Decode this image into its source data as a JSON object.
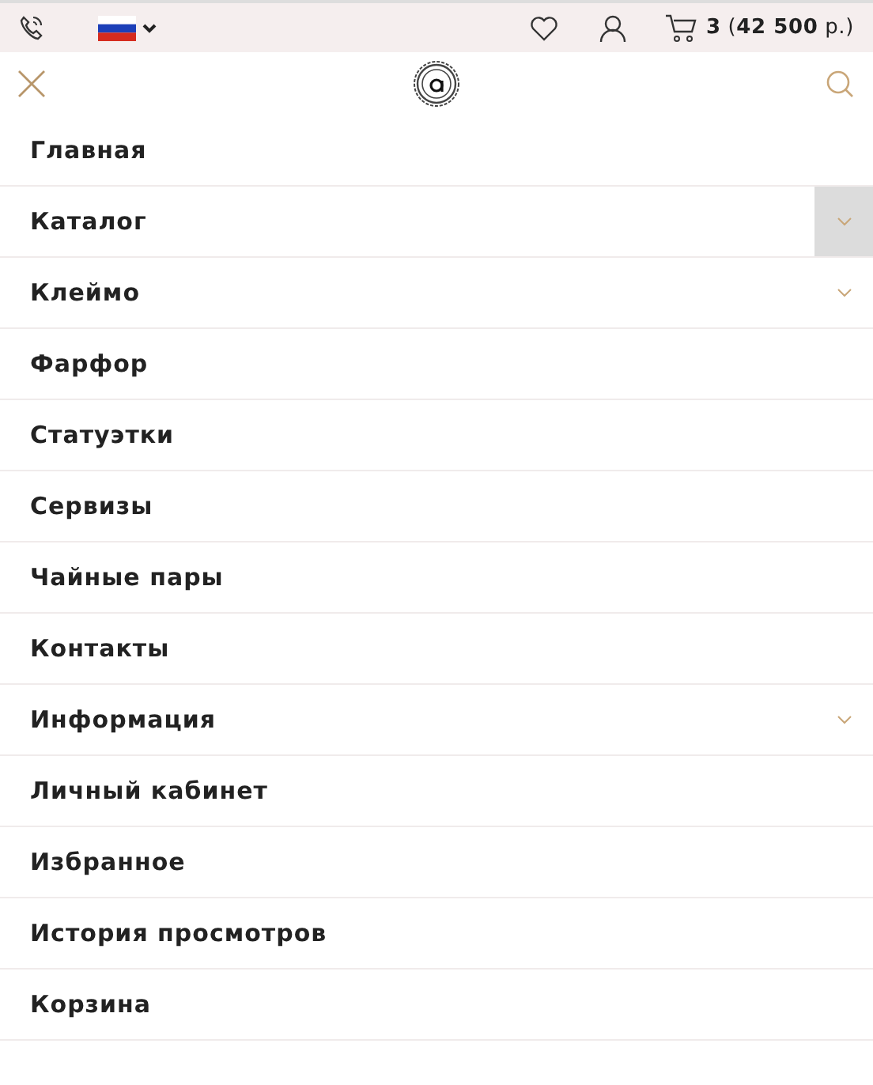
{
  "top_bar": {
    "cart_summary": "**3** (**42 500** р.)"
  },
  "menu": [
    {
      "label": "Главная",
      "submenu": false
    },
    {
      "label": "Каталог",
      "submenu": true,
      "toggle_hovered": true
    },
    {
      "label": "Клеймо",
      "submenu": true,
      "toggle_hovered": false
    },
    {
      "label": "Фарфор",
      "submenu": false
    },
    {
      "label": "Статуэтки",
      "submenu": false
    },
    {
      "label": "Сервизы",
      "submenu": false
    },
    {
      "label": "Чайные пары",
      "submenu": false
    },
    {
      "label": "Контакты",
      "submenu": false
    },
    {
      "label": "Информация",
      "submenu": true,
      "toggle_hovered": false
    },
    {
      "label": "Личный кабинет",
      "submenu": false
    },
    {
      "label": "Избранное",
      "submenu": false
    },
    {
      "label": "История просмотров",
      "submenu": false
    },
    {
      "label": "Корзина",
      "submenu": false
    }
  ]
}
